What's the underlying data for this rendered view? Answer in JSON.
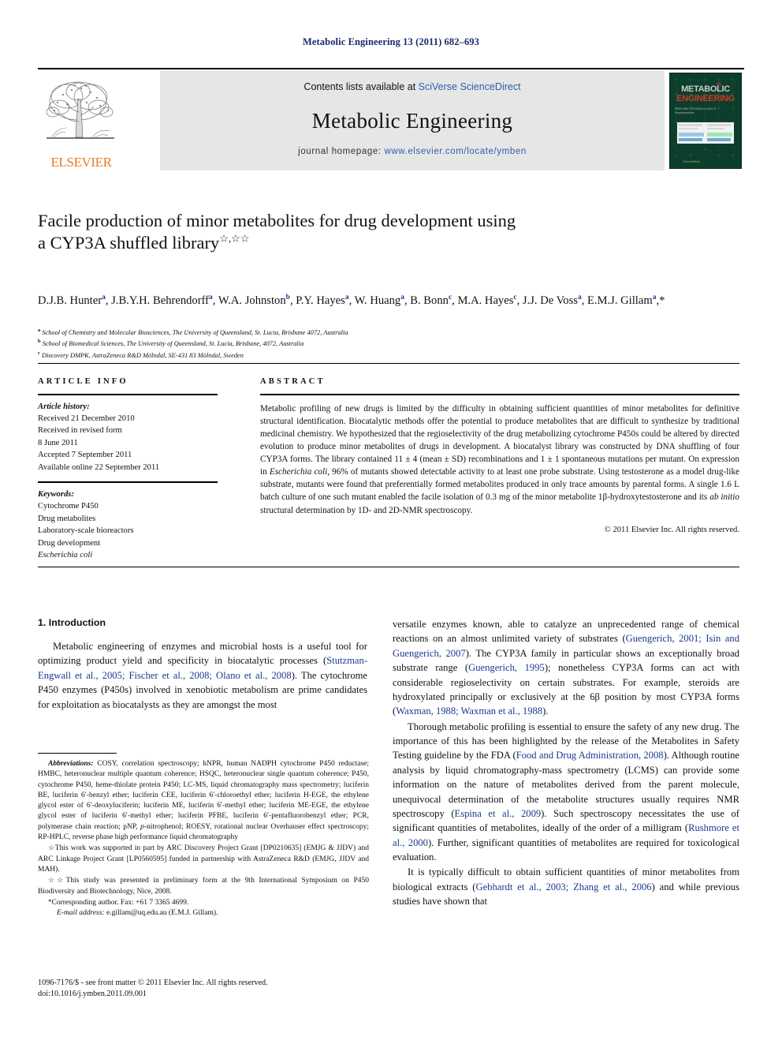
{
  "running_head": "Metabolic Engineering 13 (2011) 682–693",
  "masthead": {
    "contents_prefix": "Contents lists available at ",
    "contents_link": "SciVerse ScienceDirect",
    "journal_name": "Metabolic Engineering",
    "homepage_prefix": "journal homepage: ",
    "homepage_link": "www.elsevier.com/locate/ymben",
    "publisher_logo_text": "ELSEVIER",
    "cover": {
      "title_line1": "METABOLIC",
      "title_line2": "ENGINEERING",
      "subtitle": "ISSN 1096-7176\nEditor-in-Chief: G. Stephanopoulos",
      "footer": "ScienceDirect"
    }
  },
  "article": {
    "title_line1": "Facile production of minor metabolites for drug development using",
    "title_line2": "a CYP3A shuffled library",
    "title_marks": "☆,☆☆",
    "authors": "D.J.B. Hunter a, J.B.Y.H. Behrendorff a, W.A. Johnston b, P.Y. Hayes a, W. Huang a, B. Bonn c, M.A. Hayes c, J.J. De Voss a, E.M.J. Gillam a,*",
    "affiliations": [
      {
        "mark": "a",
        "text": "School of Chemistry and Molecular Biosciences, The University of Queensland, St. Lucia, Brisbane 4072, Australia"
      },
      {
        "mark": "b",
        "text": "School of Biomedical Sciences, The University of Queensland, St. Lucia, Brisbane, 4072, Australia"
      },
      {
        "mark": "c",
        "text": "Discovery DMPK, AstraZeneca R&D Mölndal, SE-431 83 Mölndal, Sweden"
      }
    ]
  },
  "article_info": {
    "heading": "ARTICLE INFO",
    "history_label": "Article history:",
    "history": [
      "Received 21 December 2010",
      "Received in revised form",
      "8 June 2011",
      "Accepted 7 September 2011",
      "Available online 22 September 2011"
    ],
    "keywords_label": "Keywords:",
    "keywords": [
      "Cytochrome P450",
      "Drug metabolites",
      "Laboratory-scale bioreactors",
      "Drug development",
      "Escherichia coli"
    ]
  },
  "abstract": {
    "heading": "ABSTRACT",
    "text": "Metabolic profiling of new drugs is limited by the difficulty in obtaining sufficient quantities of minor metabolites for definitive structural identification. Biocatalytic methods offer the potential to produce metabolites that are difficult to synthesize by traditional medicinal chemistry. We hypothesized that the regioselectivity of the drug metabolizing cytochrome P450s could be altered by directed evolution to produce minor metabolites of drugs in development. A biocatalyst library was constructed by DNA shuffling of four CYP3A forms. The library contained 11 ± 4 (mean ± SD) recombinations and 1 ± 1 spontaneous mutations per mutant. On expression in Escherichia coli, 96% of mutants showed detectable activity to at least one probe substrate. Using testosterone as a model drug-like substrate, mutants were found that preferentially formed metabolites produced in only trace amounts by parental forms. A single 1.6 L batch culture of one such mutant enabled the facile isolation of 0.3 mg of the minor metabolite 1β-hydroxytestosterone and its ab initio structural determination by 1D- and 2D-NMR spectroscopy.",
    "copyright": "© 2011 Elsevier Inc. All rights reserved."
  },
  "body": {
    "section_number_title": "1. Introduction",
    "left_paragraphs": [
      "Metabolic engineering of enzymes and microbial hosts is a useful tool for optimizing product yield and specificity in biocatalytic processes (Stutzman-Engwall et al., 2005; Fischer et al., 2008; Olano et al., 2008). The cytochrome P450 enzymes (P450s) involved in xenobiotic metabolism are prime candidates for exploitation as biocatalysts as they are amongst the most"
    ],
    "right_paragraphs": [
      "versatile enzymes known, able to catalyze an unprecedented range of chemical reactions on an almost unlimited variety of substrates (Guengerich, 2001; Isin and Guengerich, 2007). The CYP3A family in particular shows an exceptionally broad substrate range (Guengerich, 1995); nonetheless CYP3A forms can act with considerable regioselectivity on certain substrates. For example, steroids are hydroxylated principally or exclusively at the 6β position by most CYP3A forms (Waxman, 1988; Waxman et al., 1988).",
      "Thorough metabolic profiling is essential to ensure the safety of any new drug. The importance of this has been highlighted by the release of the Metabolites in Safety Testing guideline by the FDA (Food and Drug Administration, 2008). Although routine analysis by liquid chromatography-mass spectrometry (LCMS) can provide some information on the nature of metabolites derived from the parent molecule, unequivocal determination of the metabolite structures usually requires NMR spectroscopy (Espina et al., 2009). Such spectroscopy necessitates the use of significant quantities of metabolites, ideally of the order of a milligram (Rushmore et al., 2000). Further, significant quantities of metabolites are required for toxicological evaluation.",
      "It is typically difficult to obtain sufficient quantities of minor metabolites from biological extracts (Gebhardt et al., 2003; Zhang et al., 2006) and while previous studies have shown that"
    ]
  },
  "footnotes": {
    "abbreviations_label": "Abbreviations:",
    "abbreviations_text": "COSY, correlation spectroscopy; hNPR, human NADPH cytochrome P450 reductase; HMBC, heteronuclear multiple quantum coherence; HSQC, heteronuclear single quantum coherence; P450, cytochrome P450, heme-thiolate protein P450; LC-MS, liquid chromatography mass spectrometry; luciferin BE, luciferin 6′-benzyl ether; luciferin CEE, luciferin 6′-chloroethyl ether; luciferin H-EGE, the ethylene glycol ester of 6′-deoxyluciferin; luciferin ME, luciferin 6′-methyl ether; luciferin ME-EGE, the ethylene glycol ester of luciferin 6′-methyl ether; luciferin PFBE, luciferin 6′-pentafluorobenzyl ether; PCR, polymerase chain reaction; pNP, p-nitrophenol; ROESY, rotational nuclear Overhauser effect spectroscopy; RP-HPLC, reverse phase high performance liquid chromatography",
    "star1_mark": "☆",
    "star1_text": "This work was supported in part by ARC Discovery Project Grant [DP0210635] (EMJG & JJDV) and ARC Linkage Project Grant [LP0560595] funded in partnership with AstraZeneca R&D (EMJG, JJDV and MAH).",
    "star2_mark": "☆☆",
    "star2_text": "This study was presented in preliminary form at the 9th International Symposium on P450 Biodiversity and Biotechnology, Nice, 2008.",
    "corresponding_mark": "*",
    "corresponding_text": "Corresponding author. Fax: +61 7 3365 4699.",
    "email_label": "E-mail address:",
    "email_text": "e.gillam@uq.edu.au (E.M.J. Gillam)."
  },
  "imprint": {
    "line1": "1096-7176/$ - see front matter © 2011 Elsevier Inc. All rights reserved.",
    "line2": "doi:10.1016/j.ymben.2011.09.001"
  },
  "colors": {
    "link": "#2b5faa",
    "reference": "#1a3a8f",
    "running_head": "#1a2a6b",
    "elsevier_orange": "#eb7b20",
    "cover_green": "#0d3d2b",
    "cover_red": "#d33a2a"
  }
}
